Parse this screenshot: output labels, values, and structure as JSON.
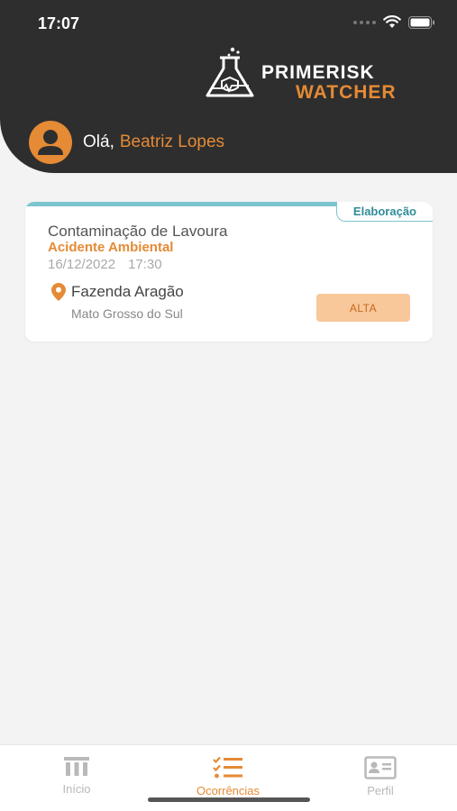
{
  "status_bar": {
    "time": "17:07"
  },
  "brand": {
    "line1_prime": "PRIME",
    "line1_risk": "RISK",
    "line2": "WATCHER"
  },
  "greeting": {
    "hello": "Olá,",
    "name": "Beatriz Lopes"
  },
  "occurrences": [
    {
      "status": "Elaboração",
      "title": "Contaminação de Lavoura",
      "type": "Acidente Ambiental",
      "date": "16/12/2022",
      "time": "17:30",
      "location_name": "Fazenda Aragão",
      "location_region": "Mato Grosso do Sul",
      "priority": "ALTA"
    }
  ],
  "nav": {
    "items": [
      {
        "label": "Início",
        "icon": "building-icon",
        "active": false
      },
      {
        "label": "Ocorrências",
        "icon": "checklist-icon",
        "active": true
      },
      {
        "label": "Perfil",
        "icon": "id-card-icon",
        "active": false
      }
    ]
  },
  "colors": {
    "accent": "#e58a35",
    "header_bg": "#2e2e2e",
    "status_teal": "#7cc4cf",
    "priority_bg": "#f8c79a"
  }
}
